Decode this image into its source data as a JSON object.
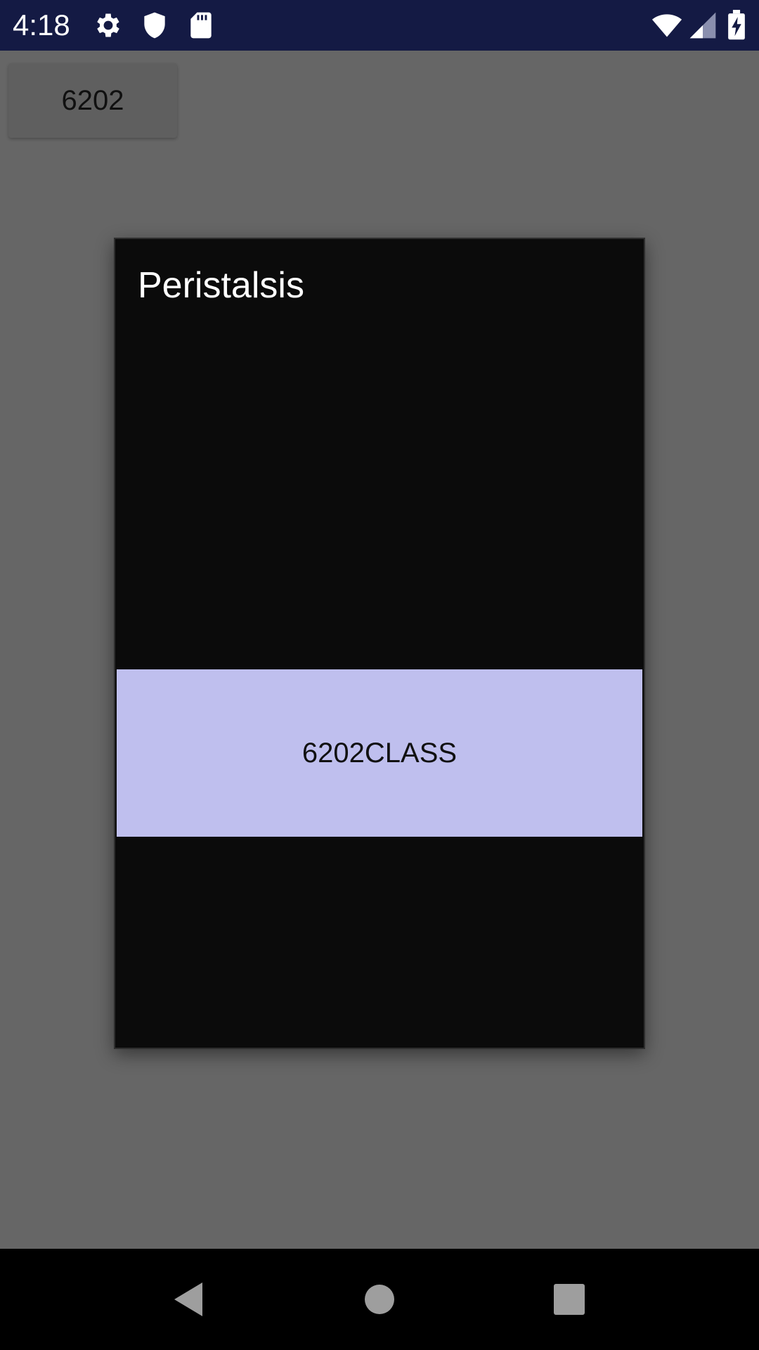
{
  "status_bar": {
    "time": "4:18",
    "left_icons": [
      "gear-icon",
      "shield-icon",
      "sd-card-icon"
    ],
    "right_icons": [
      "wifi-icon",
      "cell-signal-icon",
      "battery-charging-icon"
    ],
    "background_color": "#141a44"
  },
  "background_app": {
    "button_label": "6202"
  },
  "dialog": {
    "title": "Peristalsis",
    "options": [
      {
        "label": "6202CLASS",
        "background_color": "#bfbfee"
      }
    ]
  },
  "nav_bar": {
    "buttons": [
      "back-icon",
      "home-icon",
      "recents-icon"
    ]
  }
}
